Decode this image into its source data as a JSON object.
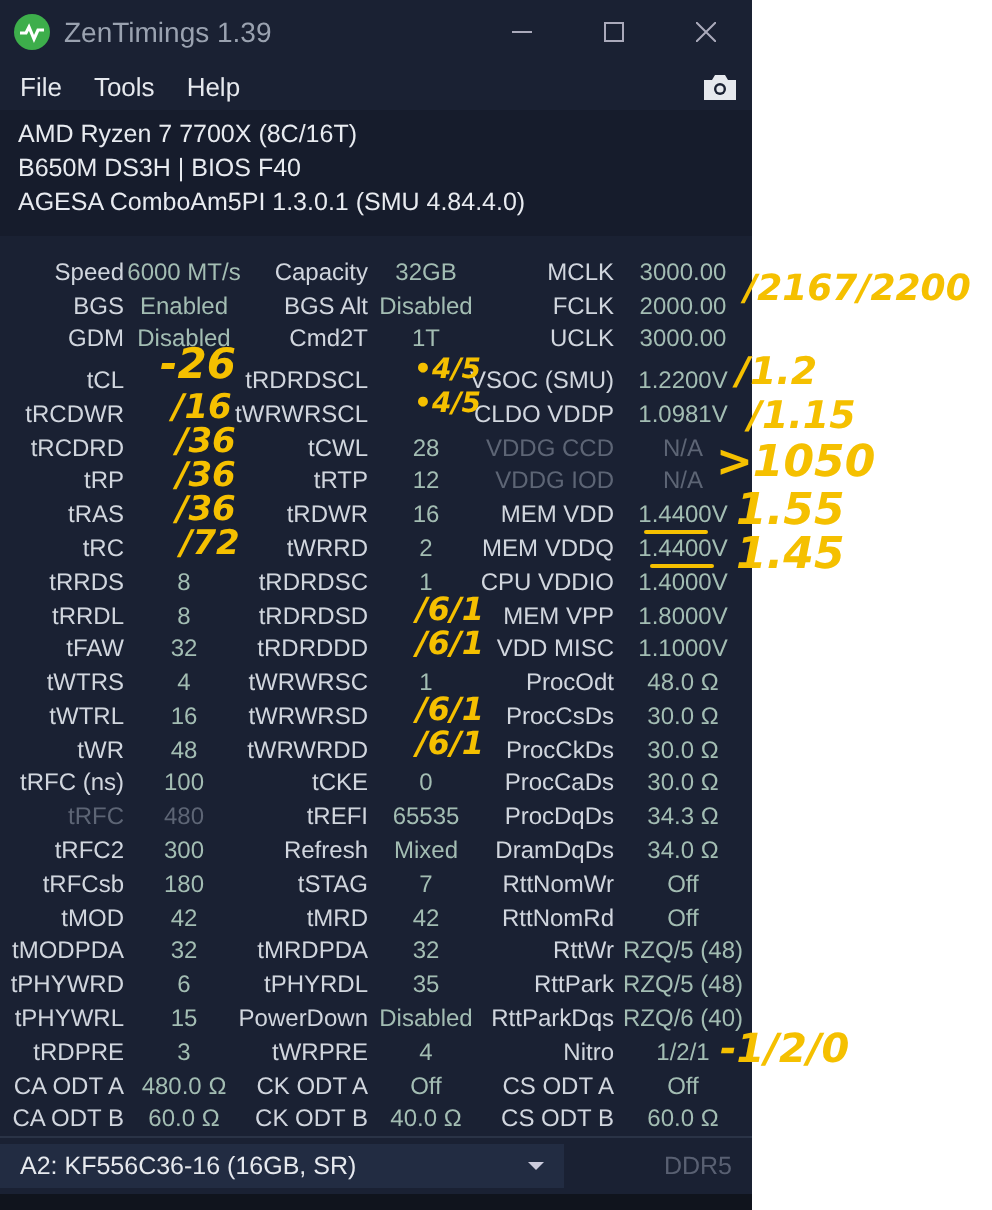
{
  "window": {
    "title": "ZenTimings 1.39"
  },
  "menu": [
    "File",
    "Tools",
    "Help"
  ],
  "info": [
    "AMD Ryzen 7 7700X (8C/16T)",
    "B650M DS3H | BIOS F40",
    "AGESA ComboAm5PI 1.3.0.1 (SMU 4.84.4.0)"
  ],
  "summary": [
    [
      {
        "label": "Speed",
        "value": "6000 MT/s"
      },
      {
        "label": "Capacity",
        "value": "32GB"
      },
      {
        "label": "MCLK",
        "value": "3000.00"
      }
    ],
    [
      {
        "label": "BGS",
        "value": "Enabled"
      },
      {
        "label": "BGS Alt",
        "value": "Disabled"
      },
      {
        "label": "FCLK",
        "value": "2000.00"
      }
    ],
    [
      {
        "label": "GDM",
        "value": "Disabled"
      },
      {
        "label": "Cmd2T",
        "value": "1T"
      },
      {
        "label": "UCLK",
        "value": "3000.00"
      }
    ]
  ],
  "timings": [
    [
      {
        "label": "tCL",
        "disabled": false
      },
      {
        "label": "tRDRDSCL",
        "disabled": false
      },
      {
        "label": "VSOC (SMU)",
        "value": "1.2200V",
        "disabled": false
      }
    ],
    [
      {
        "label": "tRCDWR",
        "disabled": false
      },
      {
        "label": "tWRWRSCL",
        "disabled": false
      },
      {
        "label": "CLDO VDDP",
        "value": "1.0981V",
        "disabled": false
      }
    ],
    [
      {
        "label": "tRCDRD",
        "disabled": false
      },
      {
        "label": "tCWL",
        "value": "28",
        "disabled": false
      },
      {
        "label": "VDDG CCD",
        "value": "N/A",
        "disabled": true
      }
    ],
    [
      {
        "label": "tRP",
        "disabled": false
      },
      {
        "label": "tRTP",
        "value": "12",
        "disabled": false
      },
      {
        "label": "VDDG IOD",
        "value": "N/A",
        "disabled": true
      }
    ],
    [
      {
        "label": "tRAS",
        "disabled": false
      },
      {
        "label": "tRDWR",
        "value": "16",
        "disabled": false
      },
      {
        "label": "MEM VDD",
        "value": "1.4400V",
        "disabled": false
      }
    ],
    [
      {
        "label": "tRC",
        "disabled": false
      },
      {
        "label": "tWRRD",
        "value": "2",
        "disabled": false
      },
      {
        "label": "MEM VDDQ",
        "value": "1.4400V",
        "disabled": false
      }
    ],
    [
      {
        "label": "tRRDS",
        "value": "8",
        "disabled": false
      },
      {
        "label": "tRDRDSC",
        "value": "1",
        "disabled": false
      },
      {
        "label": "CPU VDDIO",
        "value": "1.4000V",
        "disabled": false
      }
    ],
    [
      {
        "label": "tRRDL",
        "value": "8",
        "disabled": false
      },
      {
        "label": "tRDRDSD",
        "disabled": false
      },
      {
        "label": "MEM VPP",
        "value": "1.8000V",
        "disabled": false
      }
    ],
    [
      {
        "label": "tFAW",
        "value": "32",
        "disabled": false
      },
      {
        "label": "tRDRDDD",
        "disabled": false
      },
      {
        "label": "VDD MISC",
        "value": "1.1000V",
        "disabled": false
      }
    ],
    [
      {
        "label": "tWTRS",
        "value": "4",
        "disabled": false
      },
      {
        "label": "tWRWRSC",
        "value": "1",
        "disabled": false
      },
      {
        "label": "ProcOdt",
        "value": "48.0 Ω",
        "disabled": false
      }
    ],
    [
      {
        "label": "tWTRL",
        "value": "16",
        "disabled": false
      },
      {
        "label": "tWRWRSD",
        "disabled": false
      },
      {
        "label": "ProcCsDs",
        "value": "30.0 Ω",
        "disabled": false
      }
    ],
    [
      {
        "label": "tWR",
        "value": "48",
        "disabled": false
      },
      {
        "label": "tWRWRDD",
        "disabled": false
      },
      {
        "label": "ProcCkDs",
        "value": "30.0 Ω",
        "disabled": false
      }
    ],
    [
      {
        "label": "tRFC (ns)",
        "value": "100",
        "disabled": false
      },
      {
        "label": "tCKE",
        "value": "0",
        "disabled": false
      },
      {
        "label": "ProcCaDs",
        "value": "30.0 Ω",
        "disabled": false
      }
    ],
    [
      {
        "label": "tRFC",
        "value": "480",
        "disabled": true
      },
      {
        "label": "tREFI",
        "value": "65535",
        "disabled": false
      },
      {
        "label": "ProcDqDs",
        "value": "34.3 Ω",
        "disabled": false
      }
    ],
    [
      {
        "label": "tRFC2",
        "value": "300",
        "disabled": false
      },
      {
        "label": "Refresh",
        "value": "Mixed",
        "disabled": false
      },
      {
        "label": "DramDqDs",
        "value": "34.0 Ω",
        "disabled": false
      }
    ],
    [
      {
        "label": "tRFCsb",
        "value": "180",
        "disabled": false
      },
      {
        "label": "tSTAG",
        "value": "7",
        "disabled": false
      },
      {
        "label": "RttNomWr",
        "value": "Off",
        "disabled": false
      }
    ],
    [
      {
        "label": "tMOD",
        "value": "42",
        "disabled": false
      },
      {
        "label": "tMRD",
        "value": "42",
        "disabled": false
      },
      {
        "label": "RttNomRd",
        "value": "Off",
        "disabled": false
      }
    ],
    [
      {
        "label": "tMODPDA",
        "value": "32",
        "disabled": false
      },
      {
        "label": "tMRDPDA",
        "value": "32",
        "disabled": false
      },
      {
        "label": "RttWr",
        "value": "RZQ/5 (48)",
        "disabled": false
      }
    ],
    [
      {
        "label": "tPHYWRD",
        "value": "6",
        "disabled": false
      },
      {
        "label": "tPHYRDL",
        "value": "35",
        "disabled": false
      },
      {
        "label": "RttPark",
        "value": "RZQ/5 (48)",
        "disabled": false
      }
    ],
    [
      {
        "label": "tPHYWRL",
        "value": "15",
        "disabled": false
      },
      {
        "label": "PowerDown",
        "value": "Disabled",
        "disabled": false
      },
      {
        "label": "RttParkDqs",
        "value": "RZQ/6 (40)",
        "disabled": false
      }
    ],
    [
      {
        "label": "tRDPRE",
        "value": "3",
        "disabled": false
      },
      {
        "label": "tWRPRE",
        "value": "4",
        "disabled": false
      },
      {
        "label": "Nitro",
        "value": "1/2/1",
        "disabled": false
      }
    ],
    [
      {
        "label": "CA ODT A",
        "value": "480.0 Ω",
        "disabled": false
      },
      {
        "label": "CK ODT A",
        "value": "Off",
        "disabled": false
      },
      {
        "label": "CS ODT A",
        "value": "Off",
        "disabled": false
      }
    ],
    [
      {
        "label": "CA ODT B",
        "value": "60.0 Ω",
        "disabled": false
      },
      {
        "label": "CK ODT B",
        "value": "40.0 Ω",
        "disabled": false
      },
      {
        "label": "CS ODT B",
        "value": "60.0 Ω",
        "disabled": false
      }
    ]
  ],
  "module_select": {
    "value": "A2: KF556C36-16 (16GB, SR)"
  },
  "memory_type": "DDR5",
  "annotations": [
    {
      "kind": "text",
      "text": "-26"
    },
    {
      "kind": "text",
      "text": "/16"
    },
    {
      "kind": "text",
      "text": "/36"
    },
    {
      "kind": "text",
      "text": "/36"
    },
    {
      "kind": "text",
      "text": "/36"
    },
    {
      "kind": "text",
      "text": "/72"
    },
    {
      "kind": "text",
      "text": "•4/5"
    },
    {
      "kind": "text",
      "text": "•4/5"
    },
    {
      "kind": "text",
      "text": "/6/1"
    },
    {
      "kind": "text",
      "text": "/6/1"
    },
    {
      "kind": "text",
      "text": "/6/1"
    },
    {
      "kind": "text",
      "text": "/6/1"
    },
    {
      "kind": "text",
      "text": "/2167/2200"
    },
    {
      "kind": "text",
      "text": "/1.2"
    },
    {
      "kind": "text",
      "text": "/1.15"
    },
    {
      "kind": "text",
      "text": ">1050"
    },
    {
      "kind": "strike"
    },
    {
      "kind": "text",
      "text": "1.55"
    },
    {
      "kind": "strike"
    },
    {
      "kind": "text",
      "text": "1.45"
    },
    {
      "kind": "text",
      "text": "-1/2/0"
    }
  ]
}
